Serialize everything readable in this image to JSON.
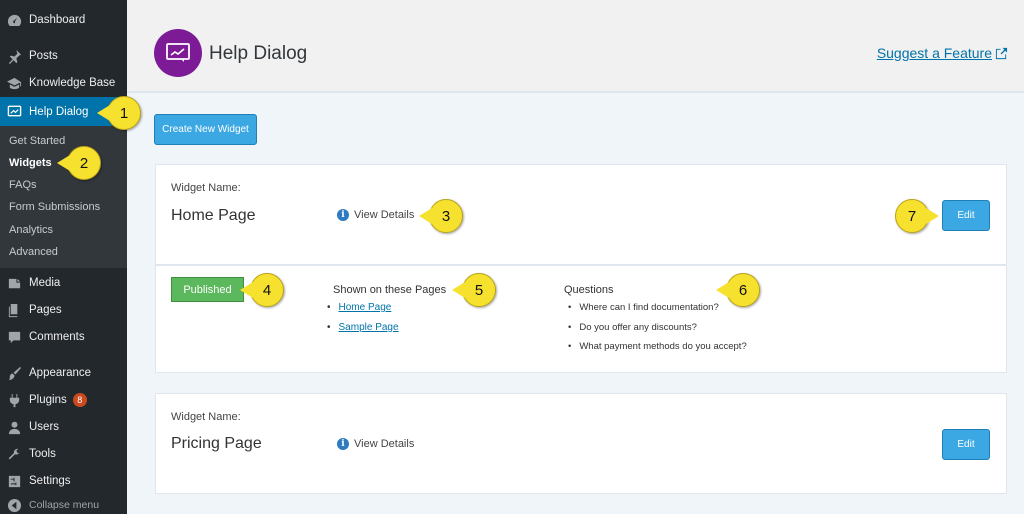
{
  "sidebar": {
    "items": [
      {
        "label": "Dashboard",
        "icon": "dashboard-icon"
      },
      {
        "label": "Posts",
        "icon": "pin-icon"
      },
      {
        "label": "Knowledge Base",
        "icon": "graduation-cap-icon"
      },
      {
        "label": "Help Dialog",
        "icon": "help-dialog-icon"
      },
      {
        "label": "Media",
        "icon": "media-icon"
      },
      {
        "label": "Pages",
        "icon": "pages-icon"
      },
      {
        "label": "Comments",
        "icon": "comment-icon"
      },
      {
        "label": "Appearance",
        "icon": "brush-icon"
      },
      {
        "label": "Plugins",
        "icon": "plug-icon",
        "badge": "8"
      },
      {
        "label": "Users",
        "icon": "user-icon"
      },
      {
        "label": "Tools",
        "icon": "wrench-icon"
      },
      {
        "label": "Settings",
        "icon": "settings-icon"
      },
      {
        "label": "Collapse menu",
        "icon": "collapse-icon"
      }
    ],
    "submenu": [
      "Get Started",
      "Widgets",
      "FAQs",
      "Form Submissions",
      "Analytics",
      "Advanced"
    ]
  },
  "header": {
    "title": "Help Dialog",
    "suggest_link": "Suggest a Feature"
  },
  "main": {
    "create_button": "Create New Widget",
    "widgets": [
      {
        "name_label": "Widget Name:",
        "name": "Home Page",
        "view_details": "View Details",
        "edit": "Edit",
        "status": "Published",
        "shown_title": "Shown on these Pages",
        "pages": [
          "Home Page",
          "Sample Page"
        ],
        "questions_title": "Questions",
        "questions": [
          "Where can I find documentation?",
          "Do you offer any discounts?",
          "What payment methods do you accept?"
        ]
      },
      {
        "name_label": "Widget Name:",
        "name": "Pricing Page",
        "view_details": "View Details",
        "edit": "Edit"
      }
    ]
  },
  "callouts": [
    "1",
    "2",
    "3",
    "4",
    "5",
    "6",
    "7"
  ],
  "colors": {
    "sidebar_bg": "#23282d",
    "active_menu": "#0073aa",
    "button_blue": "#3ba7e3",
    "published_green": "#5cb85c",
    "logo_purple": "#7d1b97",
    "callout_yellow": "#f7e12f"
  }
}
